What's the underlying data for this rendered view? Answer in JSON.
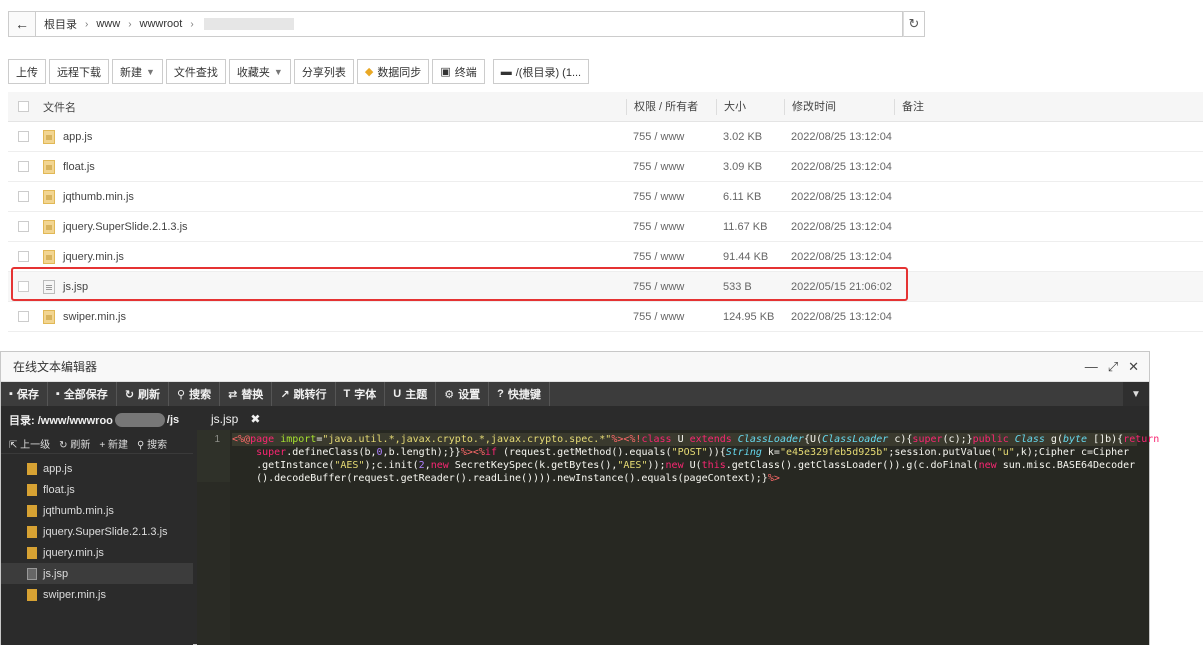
{
  "address": {
    "crumbs": [
      "根目录",
      "www",
      "wwwroot"
    ]
  },
  "toolbar": {
    "upload": "上传",
    "remote_download": "远程下载",
    "new": "新建",
    "file_search": "文件查找",
    "favorites": "收藏夹",
    "share_list": "分享列表",
    "data_sync": "数据同步",
    "terminal": "终端",
    "disk": "/(根目录) (1..."
  },
  "table": {
    "headers": {
      "name": "文件名",
      "perm": "权限 / 所有者",
      "size": "大小",
      "time": "修改时间",
      "note": "备注"
    },
    "rows": [
      {
        "name": "app.js",
        "perm": "755 / www",
        "size": "3.02 KB",
        "time": "2022/08/25 13:12:04",
        "type": "js"
      },
      {
        "name": "float.js",
        "perm": "755 / www",
        "size": "3.09 KB",
        "time": "2022/08/25 13:12:04",
        "type": "js"
      },
      {
        "name": "jqthumb.min.js",
        "perm": "755 / www",
        "size": "6.11 KB",
        "time": "2022/08/25 13:12:04",
        "type": "js"
      },
      {
        "name": "jquery.SuperSlide.2.1.3.js",
        "perm": "755 / www",
        "size": "11.67 KB",
        "time": "2022/08/25 13:12:04",
        "type": "js"
      },
      {
        "name": "jquery.min.js",
        "perm": "755 / www",
        "size": "91.44 KB",
        "time": "2022/08/25 13:12:04",
        "type": "js"
      },
      {
        "name": "js.jsp",
        "perm": "755 / www",
        "size": "533 B",
        "time": "2022/05/15 21:06:02",
        "type": "doc"
      },
      {
        "name": "swiper.min.js",
        "perm": "755 / www",
        "size": "124.95 KB",
        "time": "2022/08/25 13:12:04",
        "type": "js"
      }
    ]
  },
  "editor": {
    "title": "在线文本编辑器",
    "toolbar": {
      "save": "保存",
      "save_all": "全部保存",
      "refresh": "刷新",
      "search": "搜索",
      "replace": "替换",
      "goto": "跳转行",
      "font": "字体",
      "theme": "主题",
      "settings": "设置",
      "shortcuts": "快捷键"
    },
    "sidebar": {
      "dir_prefix": "目录: /www/wwwroo",
      "dir_suffix": "/js",
      "up": "上一级",
      "refresh": "刷新",
      "new": "新建",
      "search": "搜索",
      "files": [
        {
          "name": "app.js",
          "type": "js"
        },
        {
          "name": "float.js",
          "type": "js"
        },
        {
          "name": "jqthumb.min.js",
          "type": "js"
        },
        {
          "name": "jquery.SuperSlide.2.1.3.js",
          "type": "js"
        },
        {
          "name": "jquery.min.js",
          "type": "js"
        },
        {
          "name": "js.jsp",
          "type": "doc"
        },
        {
          "name": "swiper.min.js",
          "type": "js"
        }
      ]
    },
    "tab": "js.jsp",
    "line_number": "1"
  },
  "colors": {
    "highlight_border": "#e53333",
    "editor_bg": "#272822",
    "toolbar_bg": "#3c3c3c"
  }
}
